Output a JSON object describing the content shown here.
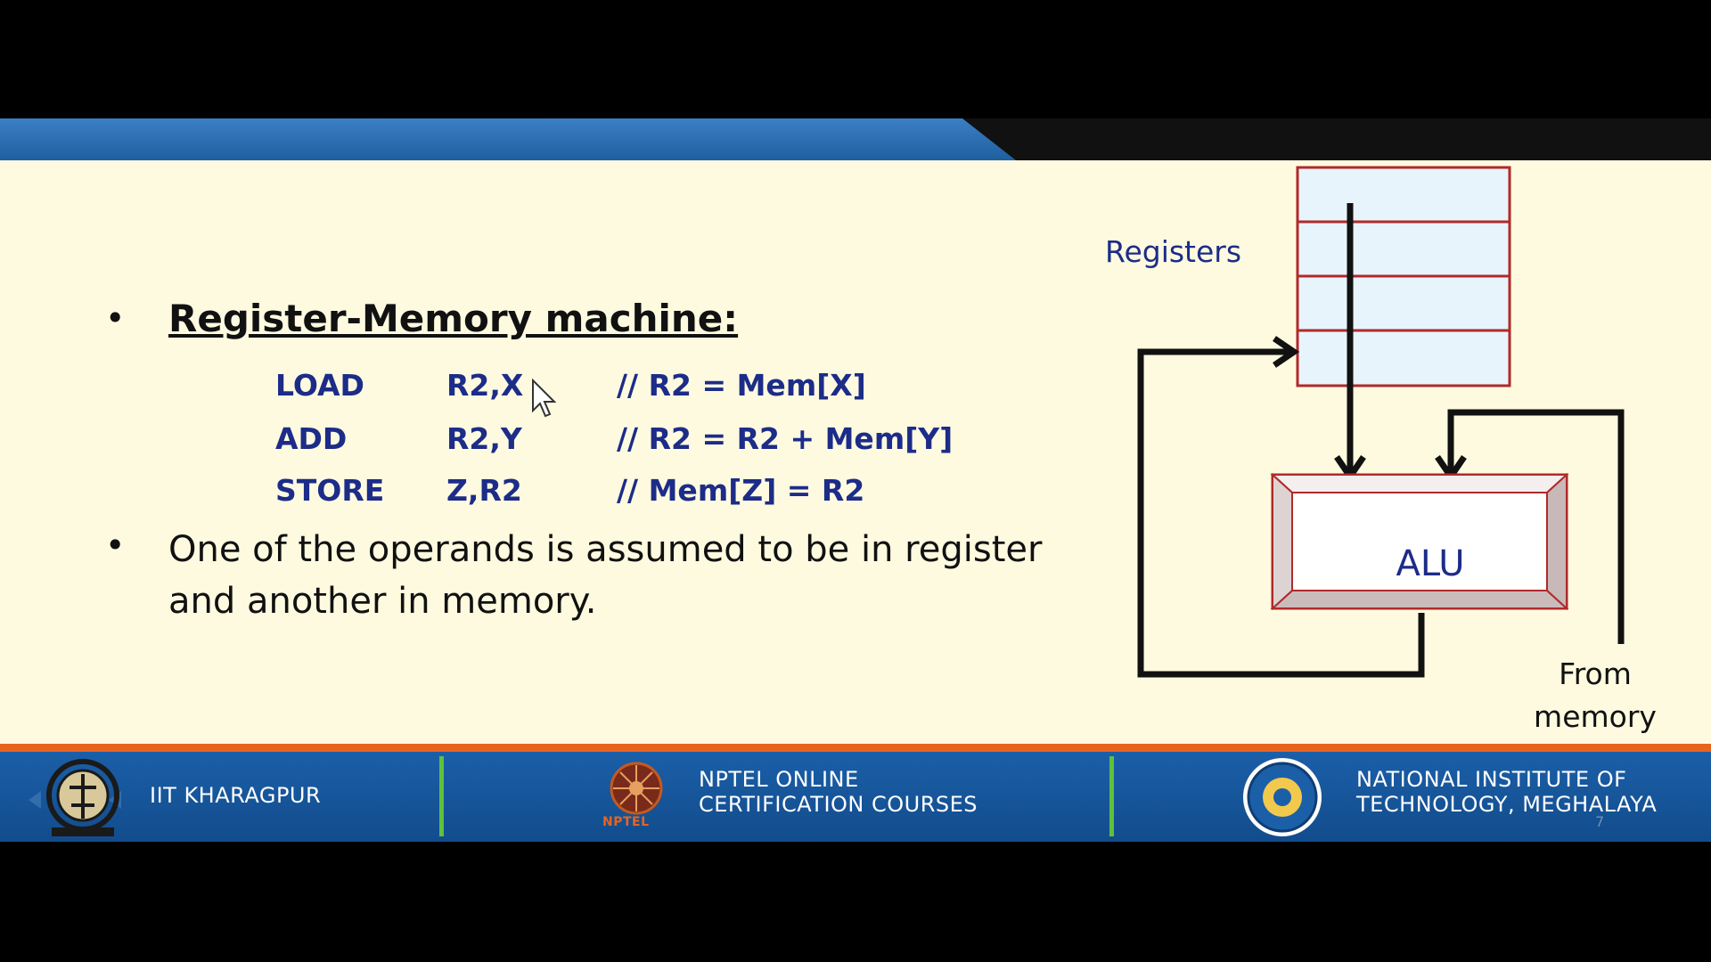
{
  "slide": {
    "title": "Register-Memory machine:",
    "code": [
      {
        "op": "LOAD",
        "args": "R2,X",
        "comment": "// R2 = Mem[X]"
      },
      {
        "op": "ADD",
        "args": "R2,Y",
        "comment": "// R2 = R2 + Mem[Y]"
      },
      {
        "op": "STORE",
        "args": "Z,R2",
        "comment": "// Mem[Z] = R2"
      }
    ],
    "description": "One of the operands is assumed to be in register and another in memory."
  },
  "diagram": {
    "registers_label": "Registers",
    "alu_label": "ALU",
    "from_memory_line1": "From",
    "from_memory_line2": "memory"
  },
  "footer": {
    "left_text": "IIT KHARAGPUR",
    "center_line1": "NPTEL ONLINE",
    "center_line2": "CERTIFICATION COURSES",
    "center_logo_text": "NPTEL",
    "right_line1": "NATIONAL INSTITUTE OF",
    "right_line2": "TECHNOLOGY, MEGHALAYA",
    "page_number": "7"
  },
  "colors": {
    "slide_bg": "#fefae0",
    "header_blue": "#2a6db3",
    "code_text": "#1c2c88",
    "footer_blue": "#1b5fa8",
    "footer_orange": "#e8641e",
    "divider_green": "#5ec13c",
    "alu_border": "#b02a2a"
  }
}
